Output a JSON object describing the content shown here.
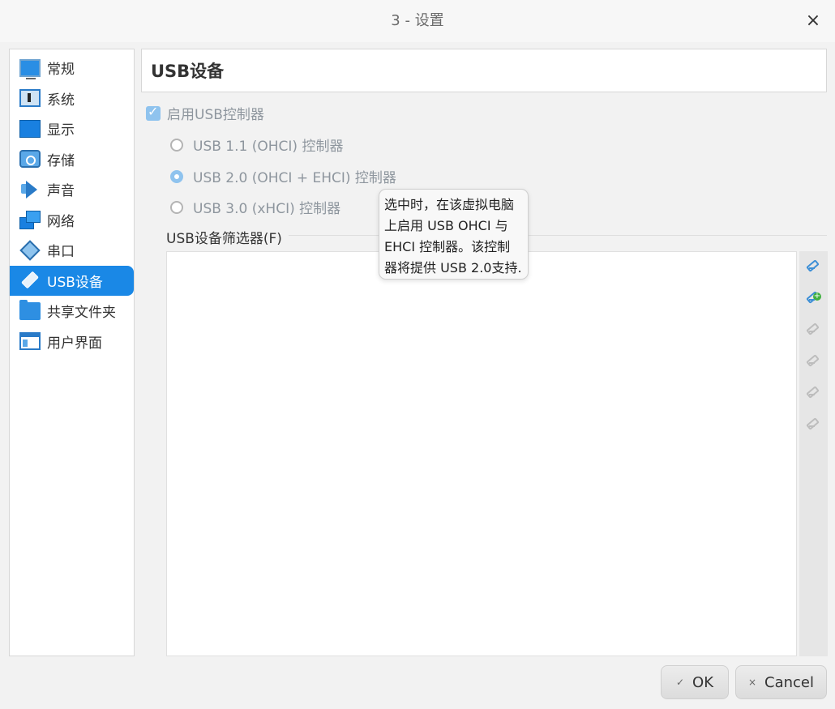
{
  "window": {
    "title": "3 - 设置",
    "close_glyph": "×"
  },
  "sidebar": {
    "items": [
      {
        "label": "常规",
        "icon": "monitor-icon"
      },
      {
        "label": "系统",
        "icon": "chip-icon"
      },
      {
        "label": "显示",
        "icon": "display-icon"
      },
      {
        "label": "存储",
        "icon": "disk-icon"
      },
      {
        "label": "声音",
        "icon": "speaker-icon"
      },
      {
        "label": "网络",
        "icon": "network-icon"
      },
      {
        "label": "串口",
        "icon": "serial-icon"
      },
      {
        "label": "USB设备",
        "icon": "usb-icon",
        "active": true
      },
      {
        "label": "共享文件夹",
        "icon": "folder-icon"
      },
      {
        "label": "用户界面",
        "icon": "ui-icon"
      }
    ]
  },
  "page": {
    "title": "USB设备"
  },
  "usb": {
    "enable_label": "启用USB控制器",
    "options": [
      {
        "label": "USB 1.1 (OHCI) 控制器",
        "selected": false
      },
      {
        "label": "USB 2.0 (OHCI + EHCI) 控制器",
        "selected": true
      },
      {
        "label": "USB 3.0 (xHCI) 控制器",
        "selected": false
      }
    ],
    "filters_label": "USB设备筛选器(F)"
  },
  "tooltip": {
    "lines": [
      "选中时，在该虚拟电脑",
      "上启用 USB OHCI 与",
      "EHCI 控制器。该控制",
      "器将提供 USB 2.0支持."
    ]
  },
  "toolbar_icons": [
    "add-filter-icon",
    "add-from-device-icon",
    "edit-filter-icon",
    "remove-filter-icon",
    "move-up-icon",
    "move-down-icon"
  ],
  "buttons": {
    "ok": "OK",
    "ok_glyph": "✓",
    "cancel": "Cancel",
    "cancel_glyph": "×"
  },
  "colors": {
    "accent": "#1a88e6",
    "disabled_text": "#8e969e"
  }
}
